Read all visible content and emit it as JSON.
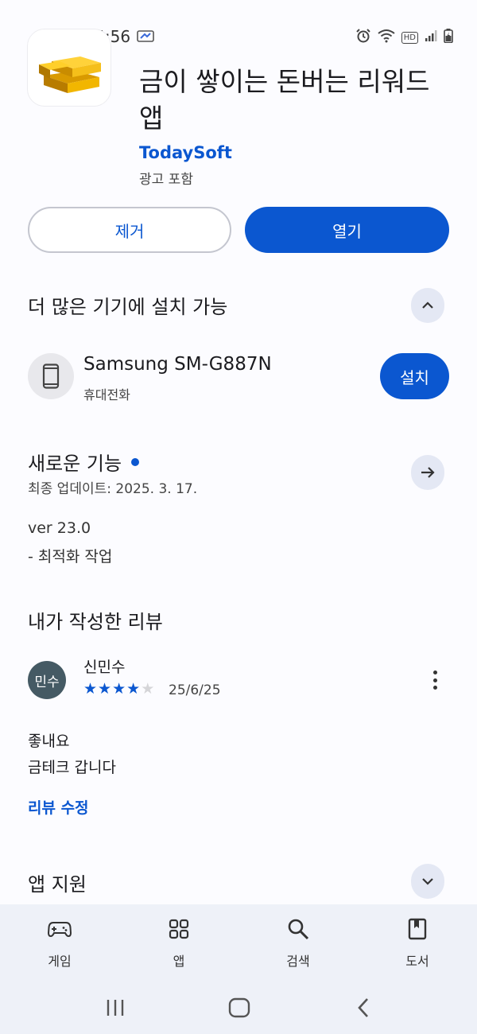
{
  "status_bar": {
    "time": "KT 5:56",
    "icons": [
      "sync-icon",
      "alarm-icon",
      "wifi-icon",
      "hd-icon",
      "signal-icon",
      "battery-charging-icon"
    ],
    "hd_label": "HD"
  },
  "app": {
    "title": "금이 쌓이는 돈버는 리워드 앱",
    "developer": "TodaySoft",
    "ads_note": "광고 포함",
    "icon": "gold-bars-icon"
  },
  "actions": {
    "uninstall_label": "제거",
    "open_label": "열기"
  },
  "more_devices": {
    "title": "더 많은 기기에 설치 가능",
    "toggle_icon": "chevron-up-icon",
    "device": {
      "name": "Samsung SM-G887N",
      "type": "휴대전화",
      "icon": "phone-icon",
      "install_label": "설치"
    }
  },
  "whats_new": {
    "title": "새로운 기능",
    "updated": "최종 업데이트: 2025. 3. 17.",
    "arrow_icon": "arrow-right-icon",
    "lines": [
      "ver 23.0",
      "- 최적화 작업"
    ]
  },
  "my_review": {
    "title": "내가 작성한 리뷰",
    "avatar_text": "민수",
    "reviewer": "신민수",
    "rating": 4,
    "rating_max": 5,
    "date": "25/6/25",
    "text_lines": [
      "좋내요",
      "금테크 갑니다"
    ],
    "edit_label": "리뷰 수정",
    "more_icon": "more-vert-icon"
  },
  "app_support": {
    "title": "앱 지원",
    "toggle_icon": "chevron-down-icon"
  },
  "bottom_nav": {
    "items": [
      {
        "label": "게임",
        "icon": "gamepad-icon"
      },
      {
        "label": "앱",
        "icon": "apps-grid-icon"
      },
      {
        "label": "검색",
        "icon": "search-icon"
      },
      {
        "label": "도서",
        "icon": "book-icon"
      }
    ]
  },
  "system_nav": {
    "icons": [
      "recents-icon",
      "home-icon",
      "back-icon"
    ]
  },
  "colors": {
    "accent": "#0b57d0",
    "nav_background": "#eef1f8",
    "avatar": "#455a64"
  }
}
